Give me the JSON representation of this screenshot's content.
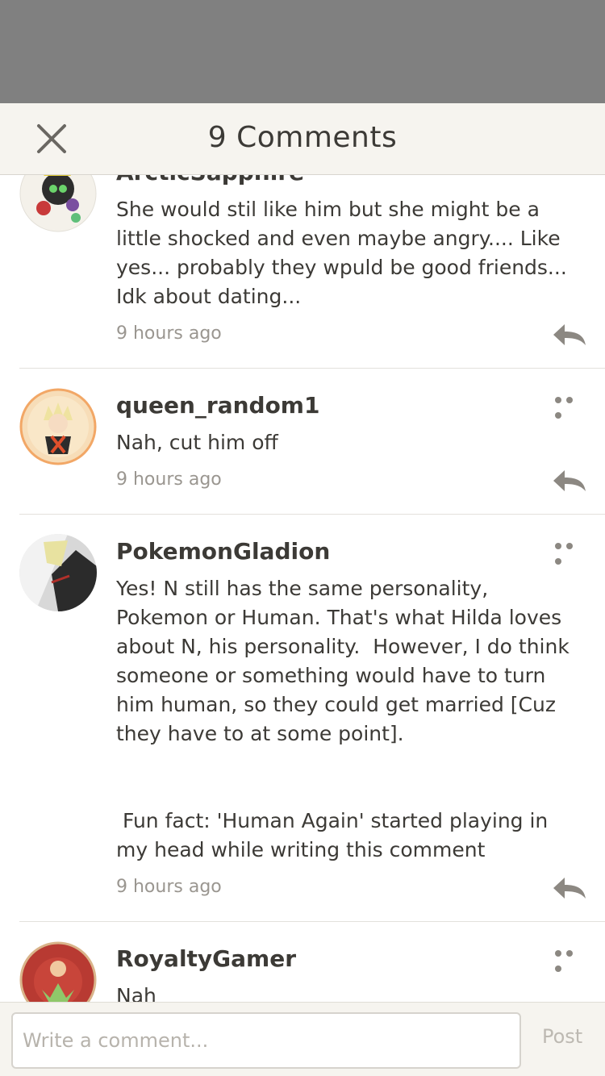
{
  "header": {
    "title": "9 Comments"
  },
  "comments": [
    {
      "username": "ArcticSapphire",
      "text": "She would stil like him but she might be a little shocked and even maybe angry.... Like yes... probably they wpuld be good friends... Idk about dating...",
      "time": "9 hours ago"
    },
    {
      "username": "queen_random1",
      "text": "Nah, cut him off",
      "time": "9 hours ago"
    },
    {
      "username": "PokemonGladion",
      "text": "Yes! N still has the same personality, Pokemon or Human. That's what Hilda loves about N, his personality.  However, I do think someone or something would have to turn him human, so they could get married [Cuz they have to at some point].\n\n\n Fun fact: 'Human Again' started playing in my head while writing this comment",
      "time": "9 hours ago"
    },
    {
      "username": "RoyaltyGamer",
      "text": "Nah",
      "time": ""
    }
  ],
  "footer": {
    "input_placeholder": "Write a comment...",
    "post_label": "Post"
  },
  "colors": {
    "overlay": "#808080",
    "header_bg": "#f6f4ef",
    "text": "#3c3a36",
    "muted": "#9a9690",
    "icon": "#8c8882"
  },
  "icons": {
    "close": "close-icon",
    "reply": "reply-icon",
    "more": "more-icon"
  }
}
